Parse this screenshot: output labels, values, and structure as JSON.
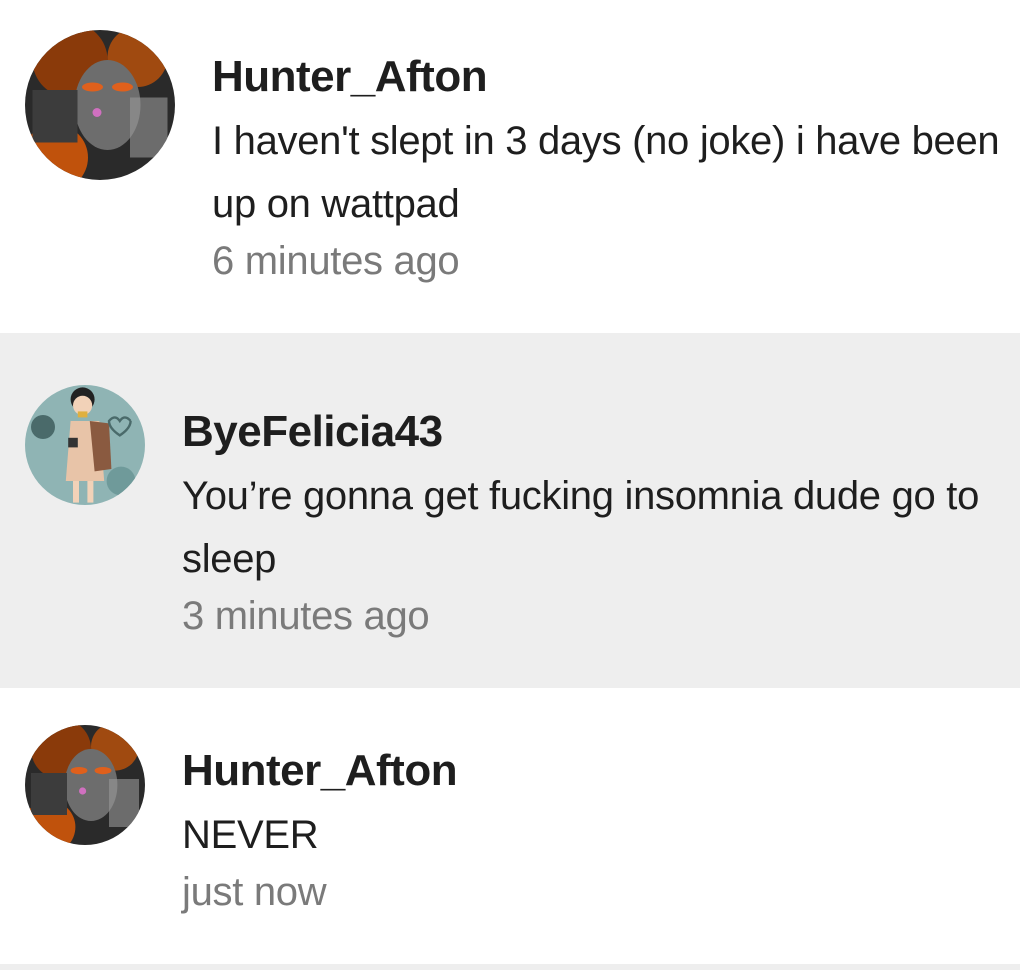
{
  "comments": [
    {
      "username": "Hunter_Afton",
      "text": "I haven't slept in 3 days (no joke) i have been up on wattpad",
      "time": "6 minutes ago",
      "avatar": "dark-orange-character-avatar"
    },
    {
      "username": "ByeFelicia43",
      "text": "You’re gonna get fucking insomnia dude go to sleep",
      "time": "3 minutes ago",
      "avatar": "teal-character-avatar"
    },
    {
      "username": "Hunter_Afton",
      "text": "NEVER",
      "time": "just now",
      "avatar": "dark-orange-character-avatar"
    }
  ],
  "colors": {
    "username": "#1e1e1e",
    "text": "#1e1e1e",
    "time": "#7a7a7a",
    "highlight_row": "#eeeeee"
  }
}
